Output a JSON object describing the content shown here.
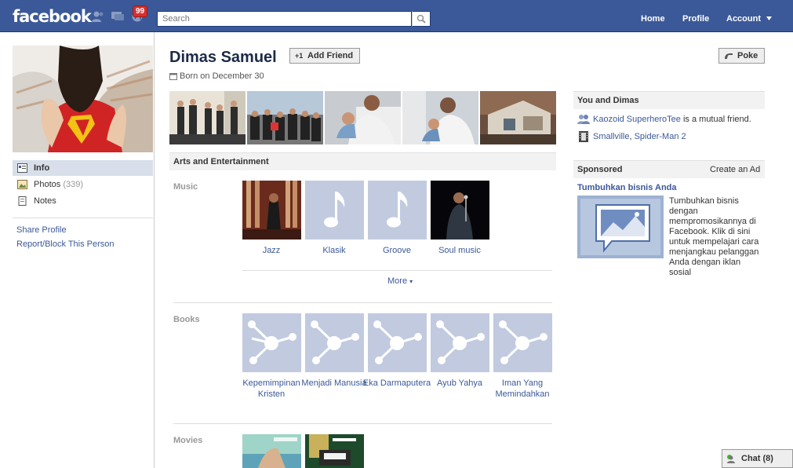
{
  "topbar": {
    "logo": "facebook",
    "notification_count": "99",
    "search_placeholder": "Search",
    "nav": [
      "Home",
      "Profile",
      "Account"
    ]
  },
  "left": {
    "nav": [
      {
        "label": "Info",
        "count": ""
      },
      {
        "label": "Photos",
        "count": "(339)"
      },
      {
        "label": "Notes",
        "count": ""
      }
    ],
    "links": [
      "Share Profile",
      "Report/Block This Person"
    ]
  },
  "profile": {
    "name": "Dimas Samuel",
    "add_friend": "Add Friend",
    "poke": "Poke",
    "birthday": "Born on December 30"
  },
  "arts": {
    "title": "Arts and Entertainment",
    "music_label": "Music",
    "music": [
      "Jazz",
      "Klasik",
      "Groove",
      "Soul music"
    ],
    "more": "More",
    "books_label": "Books",
    "books": [
      "Kepemimpinan Kristen",
      "Menjadi Manusia",
      "Eka Darmaputera",
      "Ayub Yahya",
      "Iman Yang Memindahkan"
    ],
    "movies_label": "Movies"
  },
  "right": {
    "you_and": "You and Dimas",
    "mutual_friend": "Kaozoid SuperheroTee",
    "mutual_suffix": " is a mutual friend.",
    "shared_likes": [
      "Smallville",
      "Spider-Man 2"
    ],
    "sponsored": "Sponsored",
    "create_ad": "Create an Ad",
    "ad_title": "Tumbuhkan bisnis Anda",
    "ad_text": "Tumbuhkan bisnis dengan mempromosikannya di Facebook. Klik di sini untuk mempelajari cara menjangkau pelanggan Anda dengan iklan sosial"
  },
  "chat": {
    "label": "Chat",
    "count": "(8)"
  }
}
